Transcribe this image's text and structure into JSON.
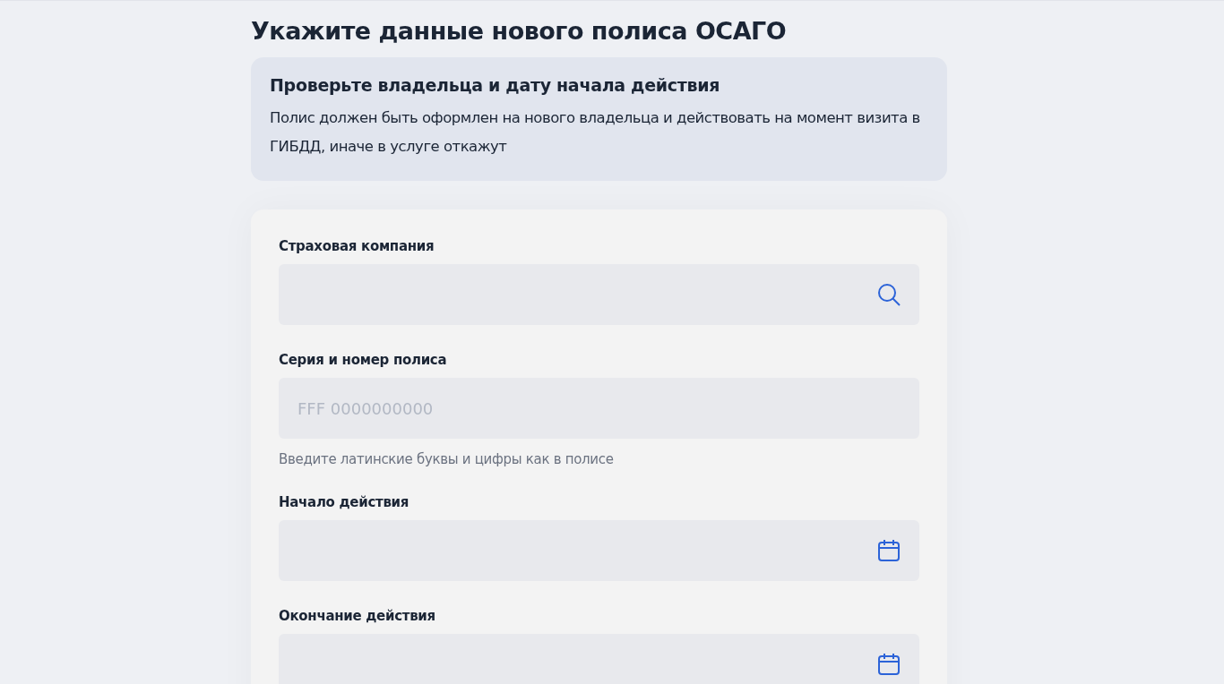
{
  "title": "Укажите данные нового полиса ОСАГО",
  "notice": {
    "heading": "Проверьте владельца и дату начала действия",
    "text": "Полис должен быть оформлен на нового владельца и действовать на момент визита в ГИБДД, иначе в услуге откажут"
  },
  "form": {
    "fields": [
      {
        "kind": "search",
        "label": "Страховая компания"
      },
      {
        "kind": "text",
        "label": "Серия и номер полиса",
        "placeholder": "FFF 0000000000",
        "hint": "Введите латинские буквы и цифры как в полисе"
      },
      {
        "kind": "date",
        "label": "Начало действия"
      },
      {
        "kind": "date",
        "label": "Окончание действия"
      }
    ]
  }
}
